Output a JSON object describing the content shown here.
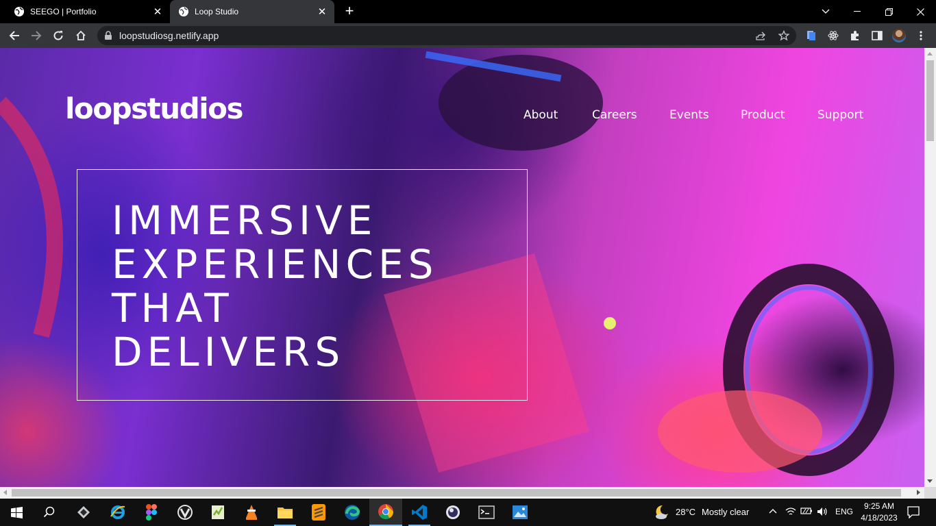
{
  "browser": {
    "tabs": [
      {
        "title": "SEEGO | Portfolio",
        "active": false
      },
      {
        "title": "Loop Studio",
        "active": true
      }
    ],
    "new_tab_label": "+",
    "url": "loopstudiosg.netlify.app"
  },
  "page": {
    "logo": "loopstudios",
    "nav": [
      {
        "label": "About"
      },
      {
        "label": "Careers"
      },
      {
        "label": "Events"
      },
      {
        "label": "Product"
      },
      {
        "label": "Support"
      }
    ],
    "hero_lines": [
      "IMMERSIVE",
      "EXPERIENCES",
      "THAT",
      "DELIVERS"
    ]
  },
  "taskbar": {
    "apps": [
      "windows-start",
      "search",
      "vectorizer",
      "internet-explorer",
      "figma",
      "vivaldi",
      "notepad-plus-plus",
      "vlc",
      "file-explorer",
      "sublime-text",
      "edge",
      "chrome",
      "vscode",
      "obs",
      "terminal",
      "photos"
    ],
    "weather_temp": "28°C",
    "weather_text": "Mostly clear",
    "language": "ENG",
    "time": "9:25 AM",
    "date": "4/18/2023"
  },
  "colors": {
    "tab_active": "#35363a",
    "toolbar": "#35363a",
    "omnibox": "#202124",
    "taskbar": "#101010",
    "accent": "#76b9ed"
  }
}
